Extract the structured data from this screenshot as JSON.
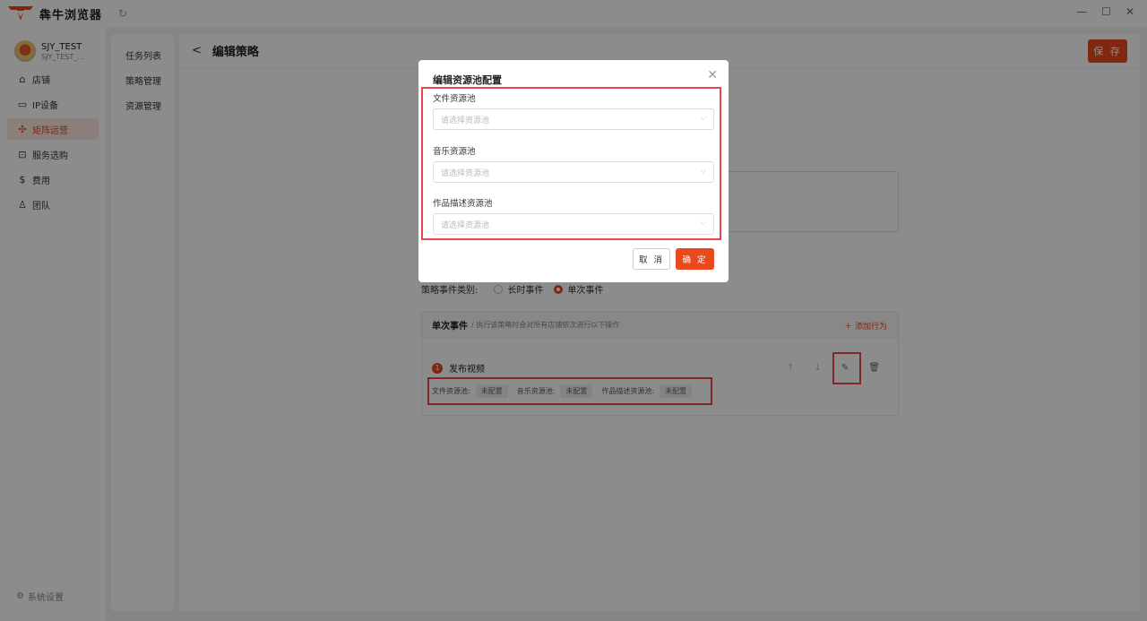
{
  "app": {
    "name": "犇牛浏览器"
  },
  "user": {
    "name": "SJY_TEST",
    "sub": "SJY_TEST_..."
  },
  "sidebar": {
    "items": [
      {
        "label": "店铺",
        "icon": "store-icon"
      },
      {
        "label": "IP设备",
        "icon": "device-icon"
      },
      {
        "label": "矩阵运营",
        "icon": "matrix-icon",
        "active": true
      },
      {
        "label": "服务选购",
        "icon": "bag-icon"
      },
      {
        "label": "费用",
        "icon": "fee-icon"
      },
      {
        "label": "团队",
        "icon": "team-icon"
      }
    ],
    "settings": "系统设置"
  },
  "subnav": {
    "items": [
      "任务列表",
      "策略管理",
      "资源管理"
    ]
  },
  "main": {
    "title": "编辑策略",
    "save": "保 存",
    "event_type_label": "策略事件类别:",
    "event_type_options": [
      "长时事件",
      "单次事件"
    ],
    "event_type_selected": "单次事件",
    "event_card": {
      "title": "单次事件",
      "desc": "/ 执行该策略时会对所有店铺依次进行以下操作",
      "add_action": "添加行为",
      "step_number": "1",
      "step_name": "发布视频",
      "tags": [
        {
          "label": "文件资源池:",
          "value": "未配置"
        },
        {
          "label": "音乐资源池:",
          "value": "未配置"
        },
        {
          "label": "作品描述资源池:",
          "value": "未配置"
        }
      ]
    }
  },
  "modal": {
    "title": "编辑资源池配置",
    "fields": [
      {
        "label": "文件资源池",
        "placeholder": "请选择资源池"
      },
      {
        "label": "音乐资源池",
        "placeholder": "请选择资源池"
      },
      {
        "label": "作品描述资源池",
        "placeholder": "请选择资源池"
      }
    ],
    "cancel": "取 消",
    "ok": "确 定"
  },
  "colors": {
    "accent": "#e8491d",
    "highlight": "#e8474c"
  }
}
